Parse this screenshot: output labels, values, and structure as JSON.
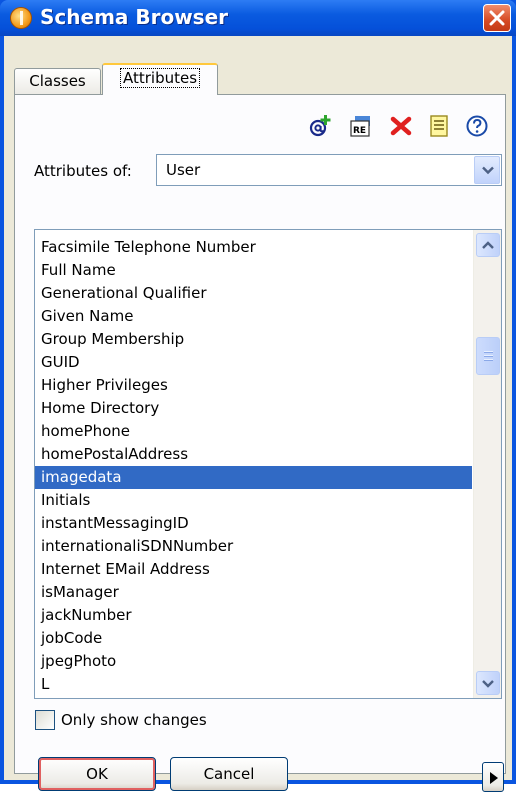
{
  "window": {
    "title": "Schema Browser"
  },
  "tabs": [
    {
      "label": "Classes"
    },
    {
      "label": "Attributes"
    }
  ],
  "toolbar": {
    "re_icon_text": "RE"
  },
  "attributes_of": {
    "label": "Attributes of:",
    "value": "User"
  },
  "list": {
    "items": [
      "Facsimile Telephone Number",
      "Full Name",
      "Generational Qualifier",
      "Given Name",
      "Group Membership",
      "GUID",
      "Higher Privileges",
      "Home Directory",
      "homePhone",
      "homePostalAddress",
      "imagedata",
      "Initials",
      "instantMessagingID",
      "internationaliSDNNumber",
      "Internet EMail Address",
      "isManager",
      "jackNumber",
      "jobCode",
      "jpegPhoto",
      "L"
    ],
    "selected": "imagedata"
  },
  "only_show_changes": {
    "label": "Only show changes",
    "checked": false
  },
  "buttons": {
    "ok": "OK",
    "cancel": "Cancel"
  },
  "colors": {
    "selection": "#316ac5",
    "titlebar": "#0a5be0",
    "close": "#d64a24",
    "dialog": "#ece9d8"
  }
}
